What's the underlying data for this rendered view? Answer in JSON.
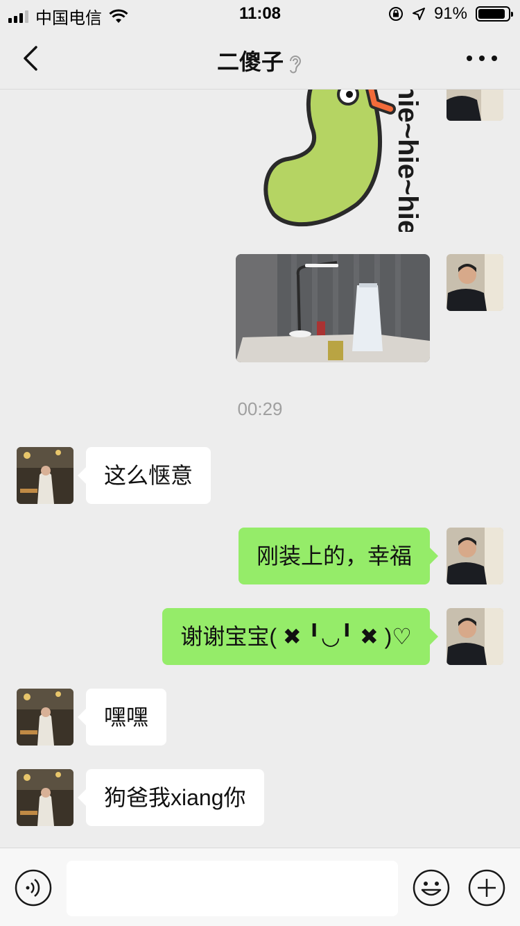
{
  "status_bar": {
    "carrier": "中国电信",
    "time": "11:08",
    "battery_percent": "91%",
    "battery_level": 0.91,
    "icons": [
      "signal-icon",
      "wifi-icon",
      "rotation-lock-icon",
      "location-arrow-icon",
      "battery-icon"
    ]
  },
  "header": {
    "title": "二傻子",
    "back_icon": "chevron-left-icon",
    "title_icon": "ear-icon",
    "more_icon": "ellipsis-icon"
  },
  "chat": {
    "sticker_text": "hie~hie~hie",
    "timestamp": "00:29",
    "messages": [
      {
        "side": "in",
        "text": "这么惬意"
      },
      {
        "side": "out",
        "text": "刚装上的，幸福"
      },
      {
        "side": "out",
        "text": "谢谢宝宝( ✖ ╹◡╹ ✖ )♡"
      },
      {
        "side": "in",
        "text": "嘿嘿"
      },
      {
        "side": "in",
        "text": "狗爸我xiang你"
      }
    ]
  },
  "input_bar": {
    "voice_icon": "voice-input-icon",
    "text_value": "",
    "emoji_icon": "emoji-icon",
    "plus_icon": "plus-circle-icon"
  },
  "colors": {
    "background": "#ededed",
    "outgoing_bubble": "#95ec69",
    "incoming_bubble": "#ffffff",
    "sticker_green": "#b5d463",
    "sticker_orange": "#f26b3a"
  }
}
